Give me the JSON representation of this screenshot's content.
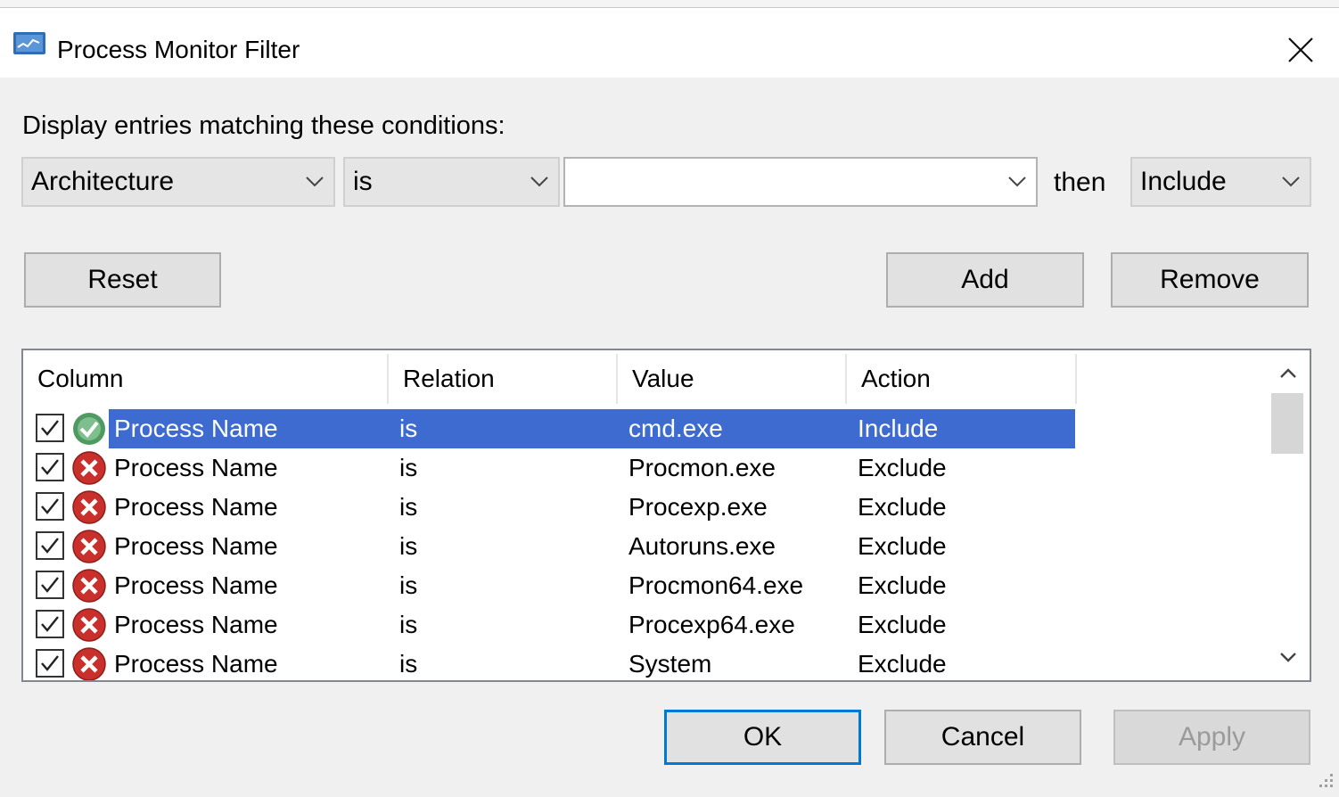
{
  "window": {
    "title": "Process Monitor Filter"
  },
  "conditions": {
    "heading": "Display entries matching these conditions:",
    "column_select": "Architecture",
    "relation_select": "is",
    "value_input": "",
    "then_label": "then",
    "action_select": "Include"
  },
  "buttons": {
    "reset": "Reset",
    "add": "Add",
    "remove": "Remove",
    "ok": "OK",
    "cancel": "Cancel",
    "apply": "Apply"
  },
  "list": {
    "headers": [
      "Column",
      "Relation",
      "Value",
      "Action"
    ],
    "rows": [
      {
        "checked": true,
        "icon": "include-check-icon",
        "column": "Process Name",
        "relation": "is",
        "value": "cmd.exe",
        "action": "Include",
        "selected": true
      },
      {
        "checked": true,
        "icon": "exclude-x-icon",
        "column": "Process Name",
        "relation": "is",
        "value": "Procmon.exe",
        "action": "Exclude",
        "selected": false
      },
      {
        "checked": true,
        "icon": "exclude-x-icon",
        "column": "Process Name",
        "relation": "is",
        "value": "Procexp.exe",
        "action": "Exclude",
        "selected": false
      },
      {
        "checked": true,
        "icon": "exclude-x-icon",
        "column": "Process Name",
        "relation": "is",
        "value": "Autoruns.exe",
        "action": "Exclude",
        "selected": false
      },
      {
        "checked": true,
        "icon": "exclude-x-icon",
        "column": "Process Name",
        "relation": "is",
        "value": "Procmon64.exe",
        "action": "Exclude",
        "selected": false
      },
      {
        "checked": true,
        "icon": "exclude-x-icon",
        "column": "Process Name",
        "relation": "is",
        "value": "Procexp64.exe",
        "action": "Exclude",
        "selected": false
      },
      {
        "checked": true,
        "icon": "exclude-x-icon",
        "column": "Process Name",
        "relation": "is",
        "value": "System",
        "action": "Exclude",
        "selected": false
      }
    ]
  },
  "colors": {
    "selection": "#3d6bd0",
    "default_button_border": "#0078d7",
    "exclude_icon": "#c9302c",
    "include_icon": "#4f9a63"
  }
}
